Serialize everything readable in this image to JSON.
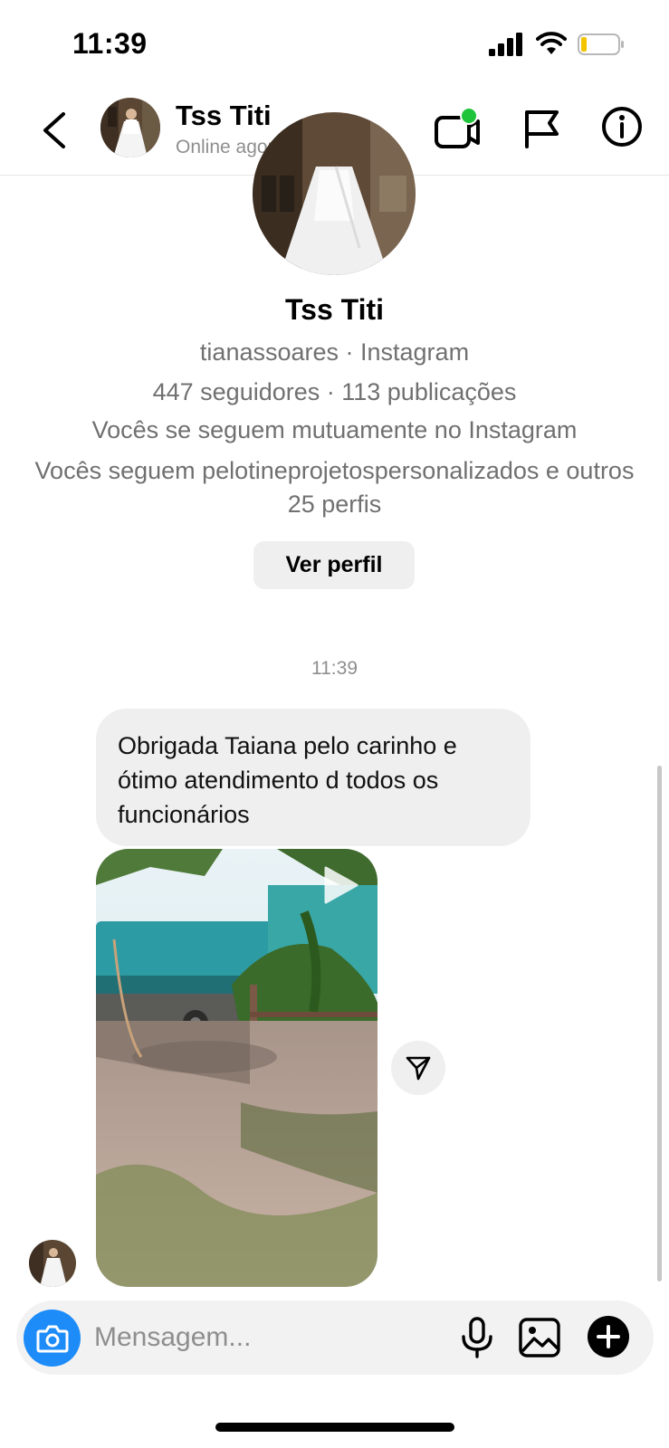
{
  "status_bar": {
    "time": "11:39",
    "battery_level": 0.15
  },
  "header": {
    "name": "Tss Titi",
    "status": "Online agora"
  },
  "profile": {
    "name": "Tss Titi",
    "handle_line": "tianassoares · Instagram",
    "stats_line": "447 seguidores · 113 publicações",
    "mutual_line": "Vocês se seguem mutuamente no Instagram",
    "following_line": "Vocês seguem pelotineprojetospersonalizados e outros 25 perfis",
    "view_profile_label": "Ver perfil"
  },
  "conversation": {
    "timestamp": "11:39",
    "messages": [
      {
        "text": "Obrigada Taiana pelo carinho e ótimo atendimento d todos os funcionários"
      }
    ]
  },
  "composer": {
    "placeholder": "Mensagem..."
  },
  "colors": {
    "accent": "#1d8cf8",
    "online": "#1fc43a",
    "bubble": "#efefef"
  }
}
